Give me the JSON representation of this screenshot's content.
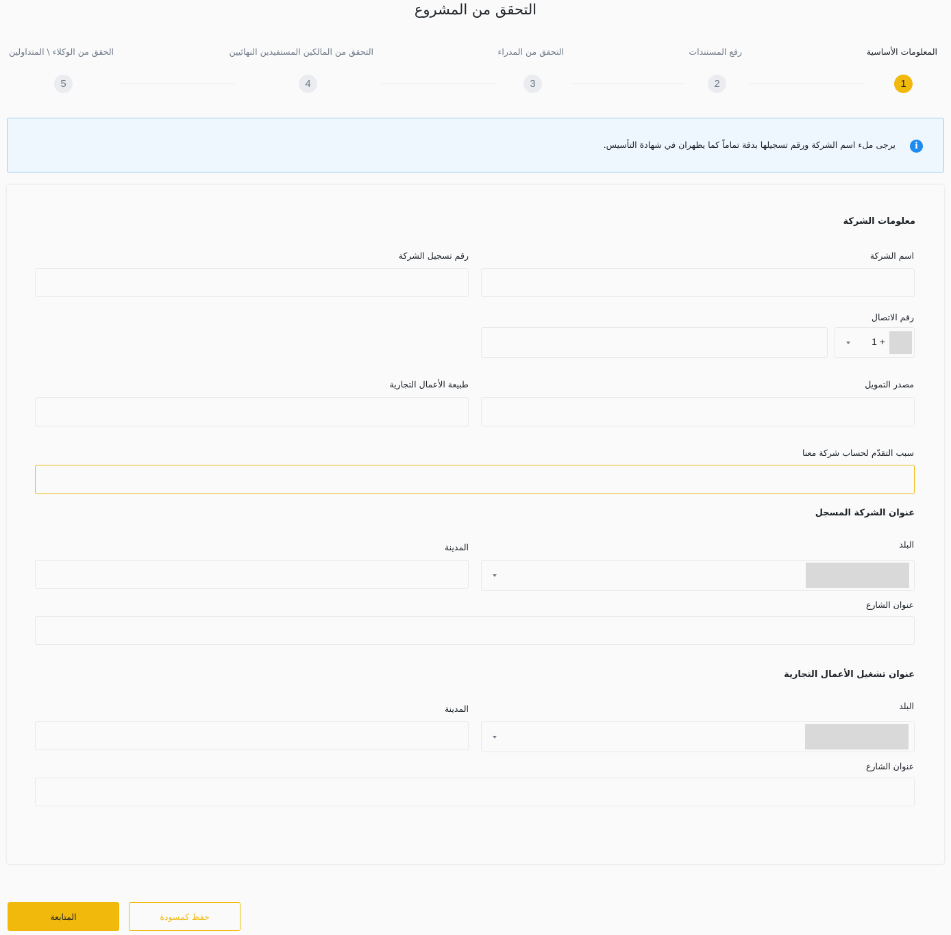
{
  "page": {
    "title": "التحقق من المشروع"
  },
  "stepper": {
    "steps": [
      {
        "number": "1",
        "label": "المعلومات الأساسية",
        "active": true
      },
      {
        "number": "2",
        "label": "رفع المستندات",
        "active": false
      },
      {
        "number": "3",
        "label": "التحقق من المدراء",
        "active": false
      },
      {
        "number": "4",
        "label": "التحقق من المالكين المستفيدين النهائيين",
        "active": false
      },
      {
        "number": "5",
        "label": "الحقق من الوكلاء \\ المتداولين",
        "active": false
      }
    ]
  },
  "info": {
    "icon": "info-icon",
    "text": "يرجى ملء اسم الشركة ورقم تسجيلها بدقة تماماً كما يظهران في شهادة التأسيس."
  },
  "company_info": {
    "title": "معلومات الشركة",
    "company_name": {
      "label": "اسم الشركة",
      "value": ""
    },
    "registration_number": {
      "label": "رقم تسجيل الشركة",
      "value": ""
    },
    "phone": {
      "label": "رقم الاتصال",
      "code": "1 +",
      "value": ""
    },
    "funding_source": {
      "label": "مصدر التمويل",
      "value": ""
    },
    "business_nature": {
      "label": "طبيعة الأعمال التجارية",
      "value": ""
    },
    "reason": {
      "label": "سبب التقدّم لحساب شركة معنا",
      "value": ""
    }
  },
  "registered_address": {
    "title": "عنوان الشركة المسجل",
    "country": {
      "label": "البلد"
    },
    "city": {
      "label": "المدينة",
      "value": ""
    },
    "street": {
      "label": "عنوان الشارع",
      "value": ""
    }
  },
  "operating_address": {
    "title": "عنوان تشغيل الأعمال التجارية",
    "country": {
      "label": "البلد"
    },
    "city": {
      "label": "المدينة",
      "value": ""
    },
    "street": {
      "label": "عنوان الشارع",
      "value": ""
    }
  },
  "actions": {
    "continue_label": "المتابعة",
    "save_draft_label": "حفظ كمسودة"
  },
  "colors": {
    "accent": "#f0b90b",
    "info_blue": "#1e8bf0",
    "info_bg": "#eef6fe"
  }
}
